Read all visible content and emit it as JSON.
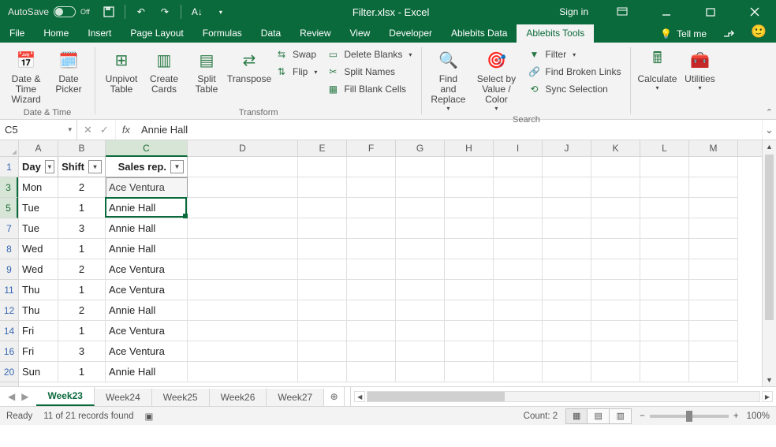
{
  "titlebar": {
    "autosave_label": "AutoSave",
    "autosave_state": "Off",
    "doc_title": "Filter.xlsx - Excel",
    "signin": "Sign in"
  },
  "tabs": {
    "items": [
      "File",
      "Home",
      "Insert",
      "Page Layout",
      "Formulas",
      "Data",
      "Review",
      "View",
      "Developer",
      "Ablebits Data",
      "Ablebits Tools"
    ],
    "active_index": 10,
    "tellme": "Tell me"
  },
  "ribbon": {
    "groups": {
      "datetime": {
        "label": "Date & Time",
        "big": [
          "Date & Time Wizard",
          "Date Picker"
        ]
      },
      "transform": {
        "label": "Transform",
        "big": [
          "Unpivot Table",
          "Create Cards",
          "Split Table",
          "Transpose"
        ],
        "small": [
          "Swap",
          "Flip",
          "Delete Blanks",
          "Split Names",
          "Fill Blank Cells"
        ]
      },
      "search": {
        "label": "Search",
        "big": [
          "Find and Replace",
          "Select by Value / Color"
        ],
        "small": [
          "Filter",
          "Find Broken Links",
          "Sync Selection"
        ]
      },
      "calc": {
        "big": [
          "Calculate",
          "Utilities"
        ]
      }
    }
  },
  "formulabar": {
    "namebox": "C5",
    "fx_label": "fx",
    "formula": "Annie Hall"
  },
  "grid": {
    "cols": [
      {
        "letter": "A",
        "w": 50
      },
      {
        "letter": "B",
        "w": 60
      },
      {
        "letter": "C",
        "w": 104
      },
      {
        "letter": "D",
        "w": 140
      },
      {
        "letter": "E",
        "w": 62
      },
      {
        "letter": "F",
        "w": 62
      },
      {
        "letter": "G",
        "w": 62
      },
      {
        "letter": "H",
        "w": 62
      },
      {
        "letter": "I",
        "w": 62
      },
      {
        "letter": "J",
        "w": 62
      },
      {
        "letter": "K",
        "w": 62
      },
      {
        "letter": "L",
        "w": 62
      },
      {
        "letter": "M",
        "w": 62
      }
    ],
    "headers": [
      "Day",
      "Shift",
      "Sales rep."
    ],
    "visible_rows": [
      {
        "n": 3,
        "day": "Mon",
        "shift": "2",
        "rep": "Ace Ventura"
      },
      {
        "n": 5,
        "day": "Tue",
        "shift": "1",
        "rep": "Annie Hall"
      },
      {
        "n": 7,
        "day": "Tue",
        "shift": "3",
        "rep": "Annie Hall"
      },
      {
        "n": 8,
        "day": "Wed",
        "shift": "1",
        "rep": "Annie Hall"
      },
      {
        "n": 9,
        "day": "Wed",
        "shift": "2",
        "rep": "Ace Ventura"
      },
      {
        "n": 11,
        "day": "Thu",
        "shift": "1",
        "rep": "Ace Ventura"
      },
      {
        "n": 12,
        "day": "Thu",
        "shift": "2",
        "rep": "Annie Hall"
      },
      {
        "n": 14,
        "day": "Fri",
        "shift": "1",
        "rep": "Ace Ventura"
      },
      {
        "n": 16,
        "day": "Fri",
        "shift": "3",
        "rep": "Ace Ventura"
      },
      {
        "n": 20,
        "day": "Sun",
        "shift": "1",
        "rep": "Annie Hall"
      }
    ],
    "header_row_n": 1,
    "selected_range_note": "C3:C5 highlighted, C5 active"
  },
  "sheets": {
    "items": [
      "Week23",
      "Week24",
      "Week25",
      "Week26",
      "Week27"
    ],
    "active_index": 0
  },
  "status": {
    "ready": "Ready",
    "filter_msg": "11 of 21 records found",
    "count_label": "Count:",
    "count_value": "2",
    "zoom": "100%"
  }
}
